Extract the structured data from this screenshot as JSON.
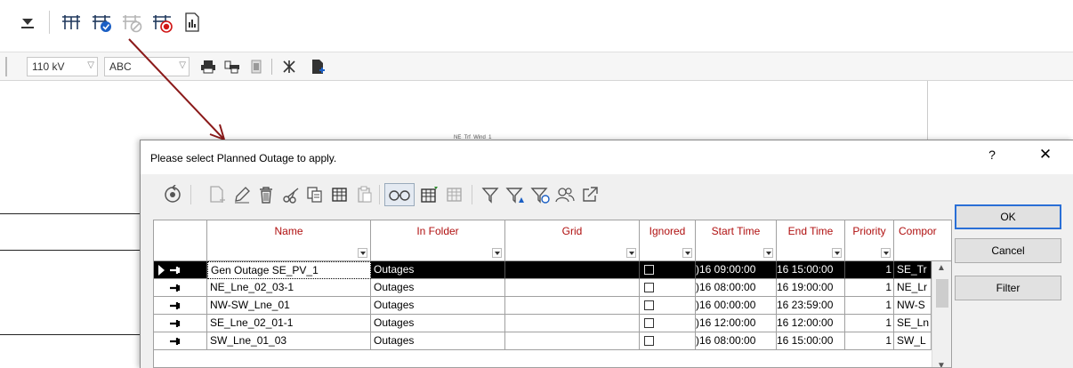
{
  "toolbar2": {
    "voltage_value": "110 kV",
    "text_value": "ABC"
  },
  "canvas": {
    "node_label": "NE_Trf_Wind_1"
  },
  "dialog": {
    "title": "Please select Planned Outage to apply.",
    "help_label": "?",
    "close_label": "✕",
    "buttons": {
      "ok": "OK",
      "cancel": "Cancel",
      "filter": "Filter"
    }
  },
  "grid": {
    "columns": [
      "Name",
      "In Folder",
      "Grid",
      "Ignored",
      "Start Time",
      "End Time",
      "Priority",
      "Compor"
    ],
    "rows": [
      {
        "name": "Gen Outage SE_PV_1",
        "folder": "Outages",
        "grid": "",
        "start": ")16 09:00:00",
        "end": "16 15:00:00",
        "priority": "1",
        "component": "SE_Tr"
      },
      {
        "name": "NE_Lne_02_03-1",
        "folder": "Outages",
        "grid": "",
        "start": ")16 08:00:00",
        "end": "16 19:00:00",
        "priority": "1",
        "component": "NE_Lr"
      },
      {
        "name": "NW-SW_Lne_01",
        "folder": "Outages",
        "grid": "",
        "start": ")16 00:00:00",
        "end": "16 23:59:00",
        "priority": "1",
        "component": "NW-S"
      },
      {
        "name": "SE_Lne_02_01-1",
        "folder": "Outages",
        "grid": "",
        "start": ")16 12:00:00",
        "end": "16 12:00:00",
        "priority": "1",
        "component": "SE_Ln"
      },
      {
        "name": "SW_Lne_01_03",
        "folder": "Outages",
        "grid": "",
        "start": ")16 08:00:00",
        "end": "16 15:00:00",
        "priority": "1",
        "component": "SW_L"
      }
    ]
  },
  "colors": {
    "header_text": "#b01010",
    "accent_blue": "#2a6fd6",
    "annotation_arrow": "#8b1a1a"
  },
  "icons": {
    "toolbar1": [
      "dropdown-triangle-icon",
      "outage-icon",
      "outage-apply-icon",
      "outage-disabled-icon",
      "outage-reset-icon",
      "report-icon"
    ],
    "dialog_toolbar": [
      "refresh-icon",
      "new-icon",
      "edit-icon",
      "delete-icon",
      "cut-icon",
      "copy-icon",
      "table-copy-icon",
      "paste-icon",
      "glasses-icon",
      "grid-edit-icon",
      "grid-disabled-icon",
      "filter-icon",
      "filter-warning-icon",
      "filter-time-icon",
      "users-icon",
      "export-icon"
    ]
  }
}
